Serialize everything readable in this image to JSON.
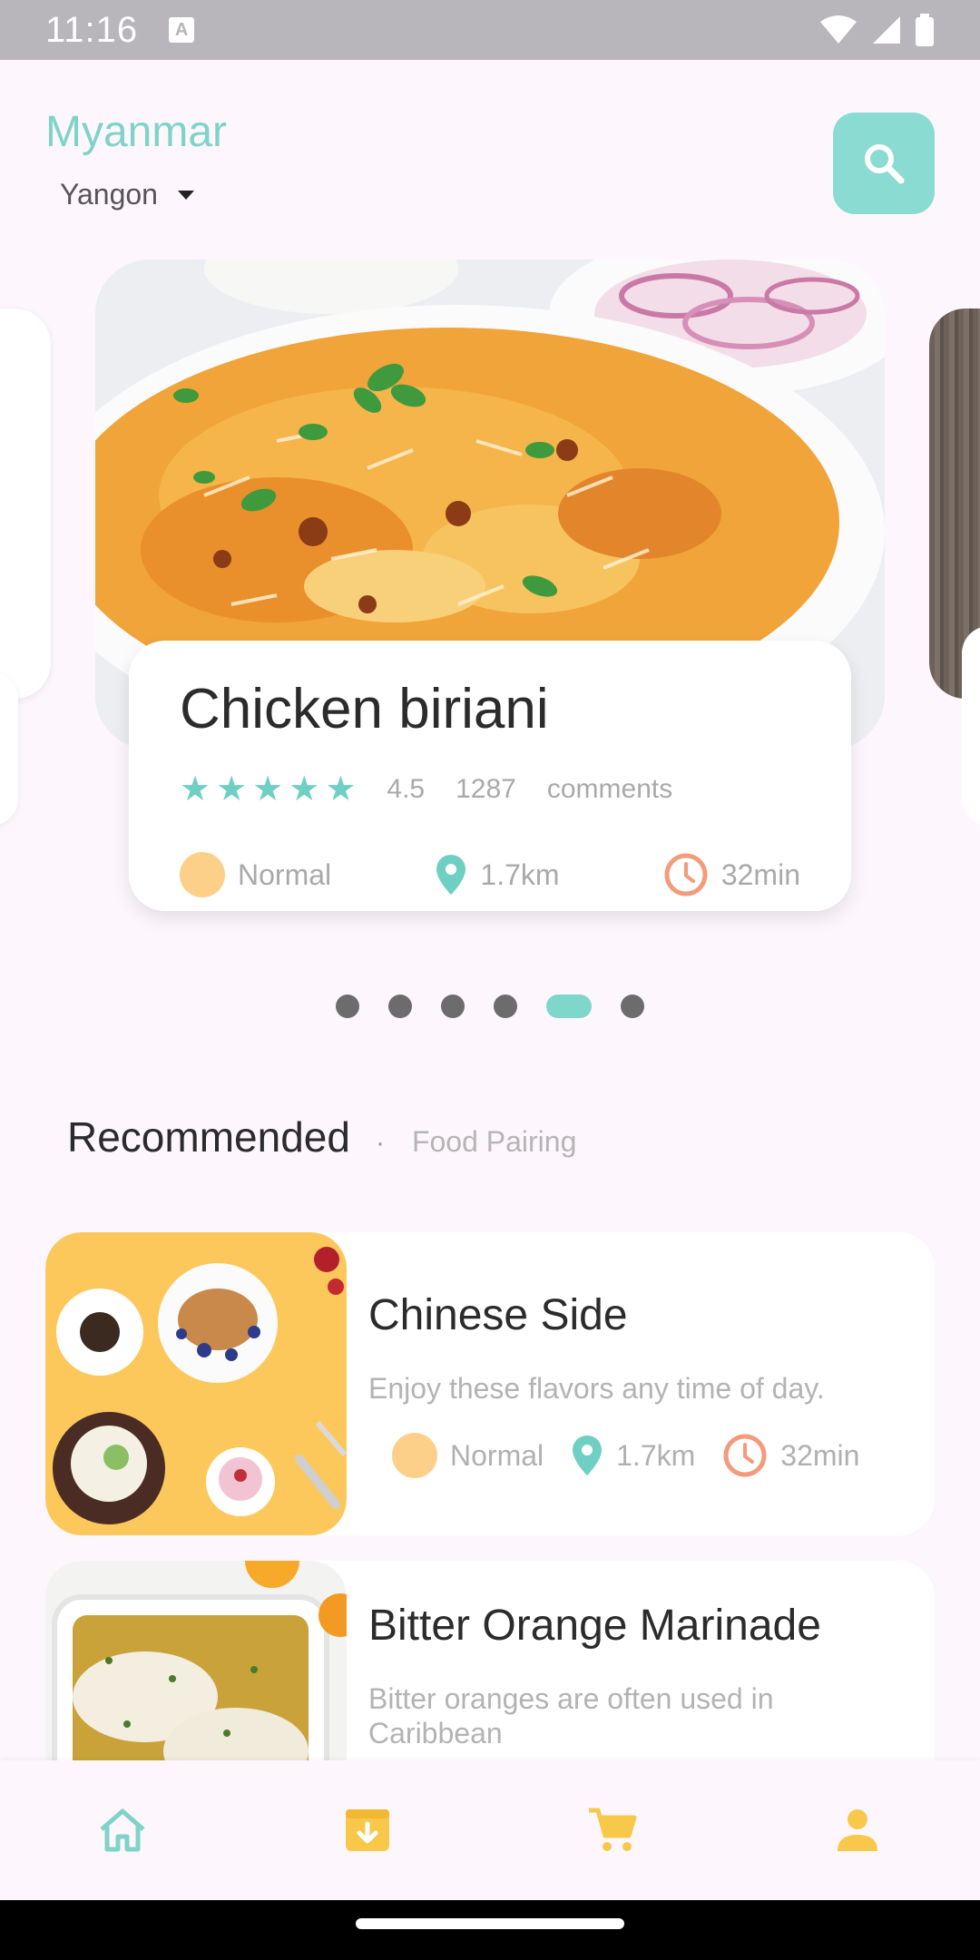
{
  "status_bar": {
    "time": "11:16",
    "notification_icon": "A"
  },
  "header": {
    "country": "Myanmar",
    "city": "Yangon",
    "search_icon": "search-icon"
  },
  "featured": {
    "title": "Chicken biriani",
    "rating": "4.5",
    "rating_stars": 5,
    "comment_count": "1287",
    "comments_label": "comments",
    "level": "Normal",
    "distance": "1.7km",
    "time": "32min"
  },
  "pager": {
    "total": 6,
    "active_index": 4
  },
  "section": {
    "title": "Recommended",
    "separator": "·",
    "subtitle": "Food Pairing"
  },
  "recommended": [
    {
      "title": "Chinese Side",
      "description": "Enjoy these flavors any time of day.",
      "level": "Normal",
      "distance": "1.7km",
      "time": "32min"
    },
    {
      "title": "Bitter Orange Marinade",
      "description": "Bitter oranges are often used in Caribbean"
    }
  ],
  "bottom_nav": [
    {
      "icon": "home-icon",
      "color": "#7fd3c8"
    },
    {
      "icon": "download-box-icon",
      "color": "#f8c84a"
    },
    {
      "icon": "cart-icon",
      "color": "#f8c84a"
    },
    {
      "icon": "person-icon",
      "color": "#f8c84a"
    }
  ],
  "colors": {
    "accent": "#7fd3c8",
    "star": "#6fcfc3",
    "clock": "#f29c7b",
    "level_dot": "#fdd08a",
    "nav_yellow": "#f8c84a"
  }
}
